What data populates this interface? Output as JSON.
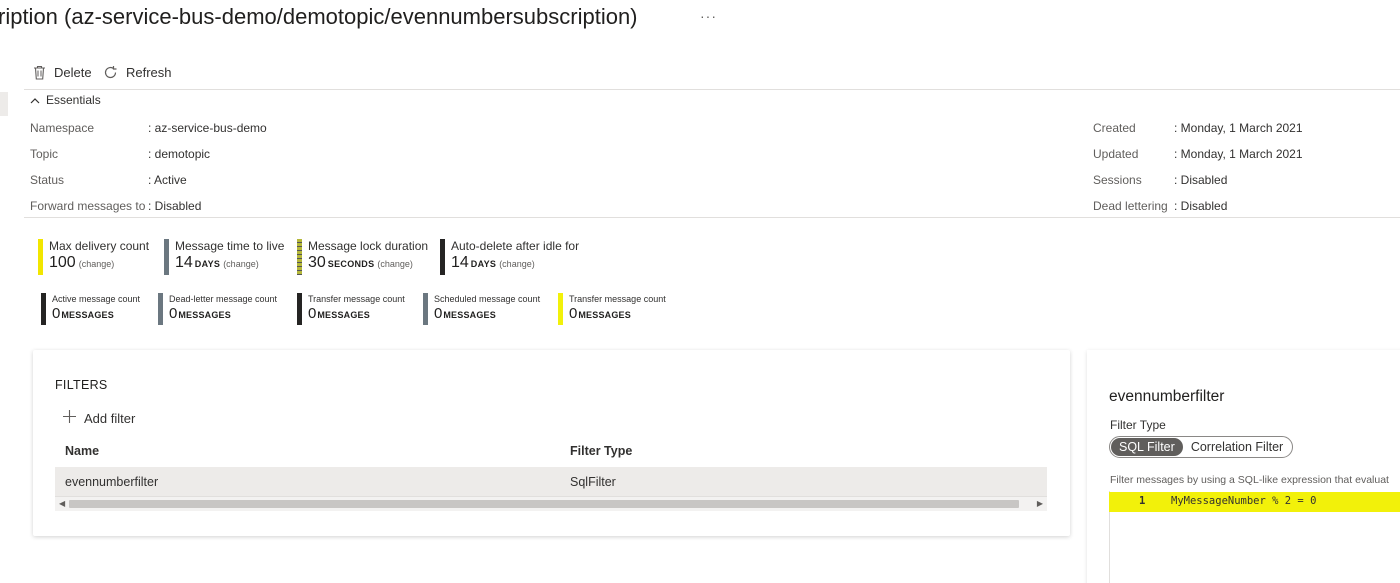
{
  "title": "ription (az-service-bus-demo/demotopic/evennumbersubscription)",
  "more_label": "···",
  "toolbar": {
    "delete_label": "Delete",
    "refresh_label": "Refresh"
  },
  "essentials": {
    "label": "Essentials",
    "left": [
      {
        "label": "Namespace",
        "value": "az-service-bus-demo"
      },
      {
        "label": "Topic",
        "value": "demotopic"
      },
      {
        "label": "Status",
        "value": "Active"
      },
      {
        "label": "Forward messages to",
        "value": "Disabled"
      }
    ],
    "right": [
      {
        "label": "Created",
        "value": "Monday, 1 March 2021"
      },
      {
        "label": "Updated",
        "value": "Monday, 1 March 2021"
      },
      {
        "label": "Sessions",
        "value": "Disabled"
      },
      {
        "label": "Dead lettering",
        "value": "Disabled"
      }
    ]
  },
  "metrics": [
    {
      "title": "Max delivery count",
      "value": "100",
      "unit": "",
      "change": "(change)",
      "color": "#f2e600"
    },
    {
      "title": "Message time to live",
      "value": "14",
      "unit": "DAYS",
      "change": "(change)",
      "color": "#6b7780"
    },
    {
      "title": "Message lock duration",
      "value": "30",
      "unit": "SECONDS",
      "change": "(change)",
      "color": "#b5b83a"
    },
    {
      "title": "Auto-delete after idle for",
      "value": "14",
      "unit": "DAYS",
      "change": "(change)",
      "color": "#252423"
    }
  ],
  "counts": [
    {
      "title": "Active message count",
      "value": "0",
      "unit": "MESSAGES",
      "color": "#252423"
    },
    {
      "title": "Dead-letter message count",
      "value": "0",
      "unit": "MESSAGES",
      "color": "#6b7780"
    },
    {
      "title": "Transfer message count",
      "value": "0",
      "unit": "MESSAGES",
      "color": "#252423"
    },
    {
      "title": "Scheduled message count",
      "value": "0",
      "unit": "MESSAGES",
      "color": "#6b7780"
    },
    {
      "title": "Transfer message count",
      "value": "0",
      "unit": "MESSAGES",
      "color": "#f2f10a"
    }
  ],
  "filters": {
    "heading": "FILTERS",
    "add_label": "Add filter",
    "columns": [
      "Name",
      "Filter Type"
    ],
    "rows": [
      {
        "name": "evennumberfilter",
        "type": "SqlFilter"
      }
    ]
  },
  "filter_detail": {
    "name": "evennumberfilter",
    "type_label": "Filter Type",
    "options": [
      "SQL Filter",
      "Correlation Filter"
    ],
    "selected": "SQL Filter",
    "help_text": "Filter messages by using a SQL-like expression that evaluat",
    "line_number": "1",
    "expression": "MyMessageNumber % 2 = 0"
  }
}
